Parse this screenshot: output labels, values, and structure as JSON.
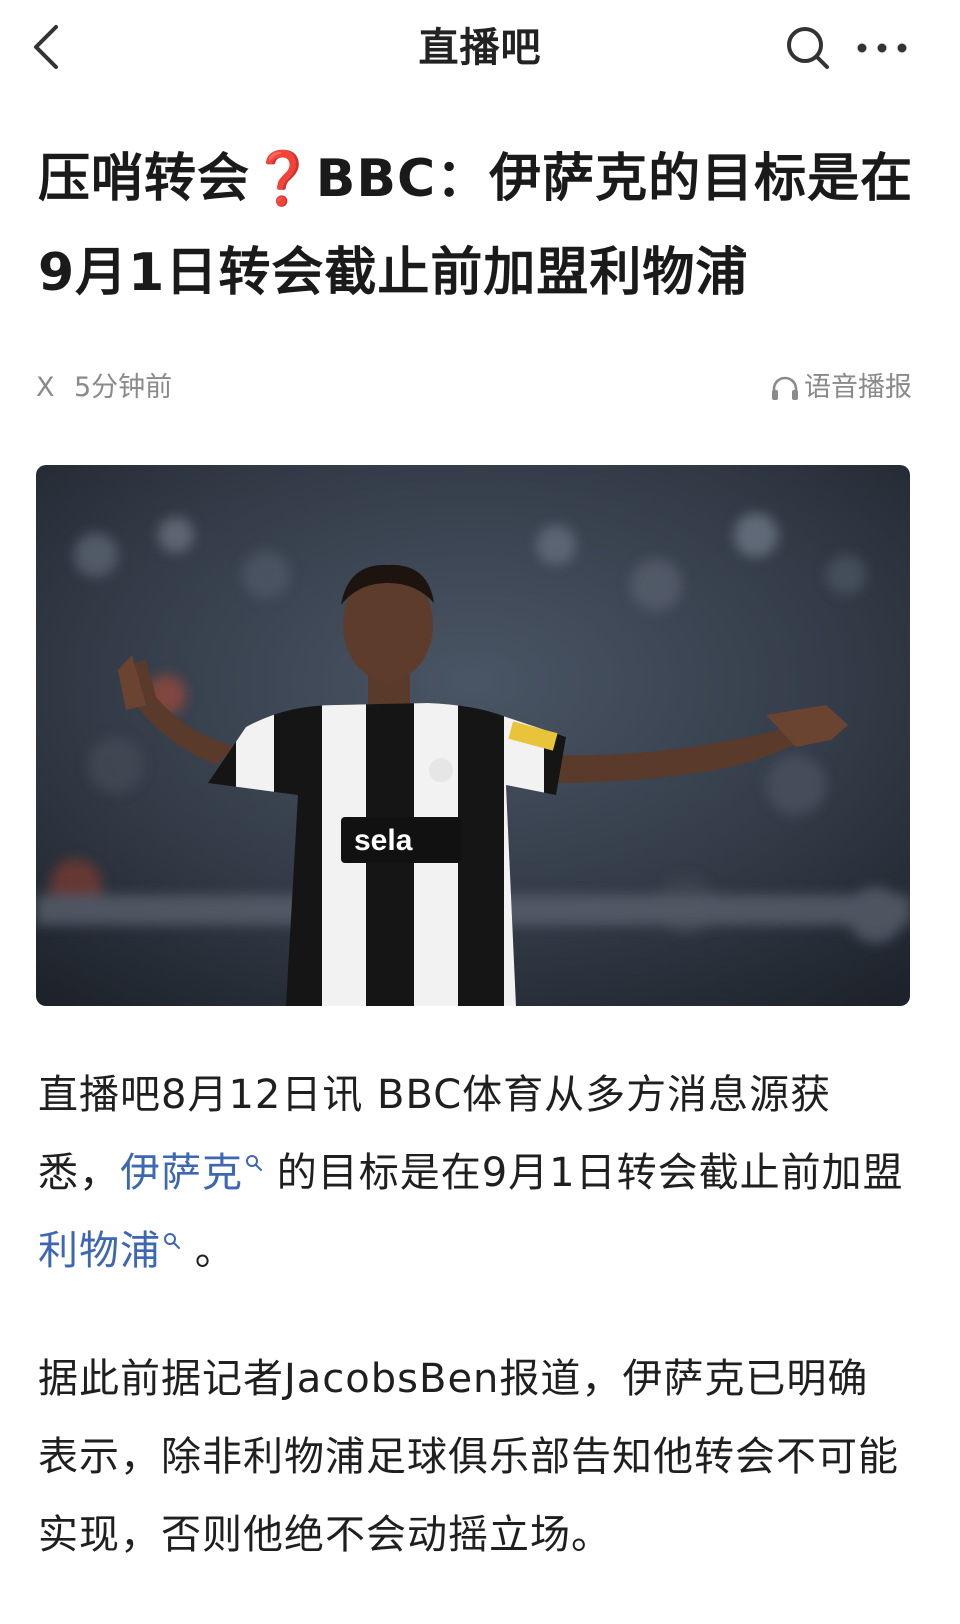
{
  "header": {
    "title": "直播吧"
  },
  "article": {
    "headline": "压哨转会❓BBC：伊萨克的目标是在9月1日转会截止前加盟利物浦",
    "meta": {
      "author": "X",
      "time": "5分钟前",
      "audio_label": "语音播报"
    },
    "hero_image": {
      "kit_sponsor_text": "sela"
    },
    "paragraph1": {
      "prefix": "直播吧8月12日讯 BBC体育从多方消息源获悉，",
      "link1": "伊萨克",
      "middle": " 的目标是在9月1日转会截止前加盟",
      "link2": "利物浦",
      "suffix": " 。"
    },
    "paragraph2": "据此前据记者JacobsBen报道，伊萨克已明确表示，除非利物浦足球俱乐部告知他转会不可能实现，否则他绝不会动摇立场。"
  },
  "colors": {
    "link": "#3d66b3",
    "meta_gray": "#8a8a8a",
    "text": "#1f1f1f"
  },
  "icons": [
    "chevron-left-icon",
    "search-icon",
    "more-icon",
    "headphones-icon",
    "search-mini-icon"
  ]
}
